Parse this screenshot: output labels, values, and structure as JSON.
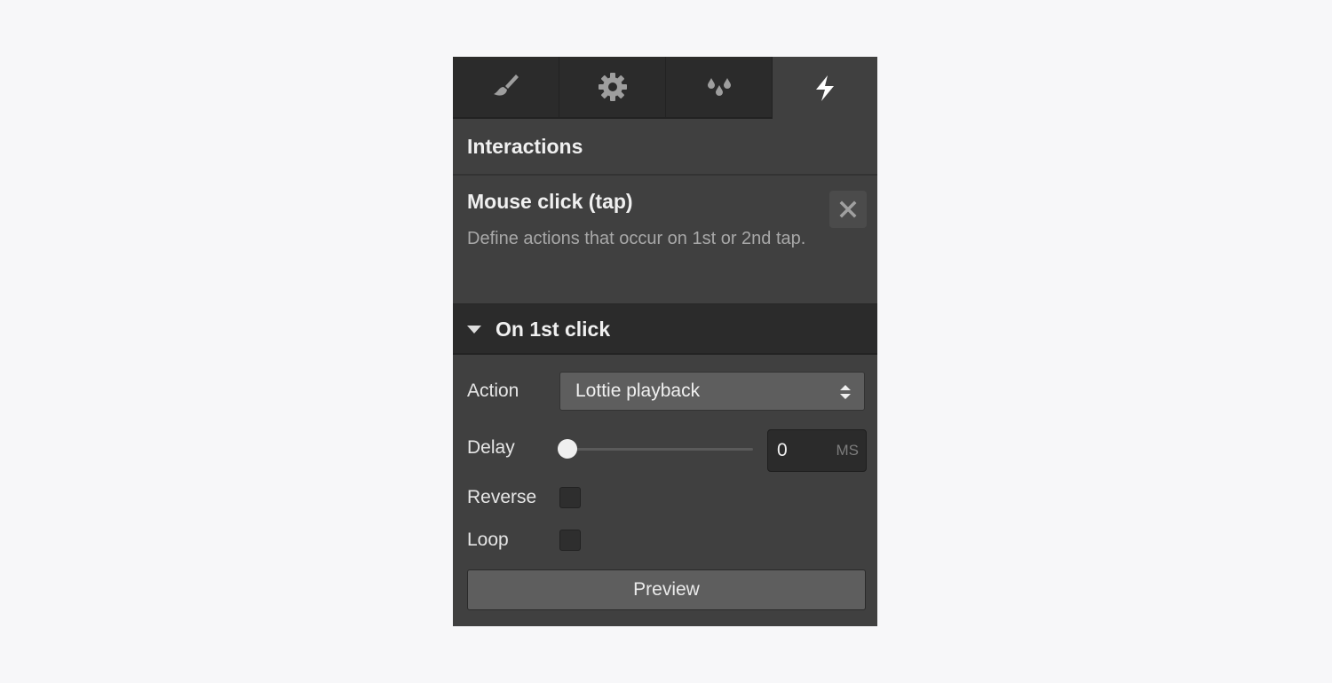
{
  "tabs": [
    {
      "name": "style",
      "icon": "paintbrush-icon",
      "active": false
    },
    {
      "name": "settings",
      "icon": "gear-icon",
      "active": false
    },
    {
      "name": "style-manager",
      "icon": "droplets-icon",
      "active": false
    },
    {
      "name": "interactions",
      "icon": "lightning-bolt-icon",
      "active": true
    }
  ],
  "section": {
    "title": "Interactions"
  },
  "trigger": {
    "title": "Mouse click (tap)",
    "description": "Define actions that occur on 1st or 2nd tap.",
    "close_icon": "close-icon"
  },
  "group": {
    "title": "On 1st click",
    "expanded": true
  },
  "fields": {
    "action": {
      "label": "Action",
      "value": "Lottie playback"
    },
    "delay": {
      "label": "Delay",
      "value": "0",
      "unit": "MS",
      "slider_fraction": 0
    },
    "reverse": {
      "label": "Reverse",
      "checked": false
    },
    "loop": {
      "label": "Loop",
      "checked": false
    }
  },
  "preview_button": {
    "label": "Preview"
  },
  "colors": {
    "panel_bg": "#404040",
    "tab_inactive_bg": "#2b2b2b",
    "page_bg": "#f7f7f9"
  }
}
